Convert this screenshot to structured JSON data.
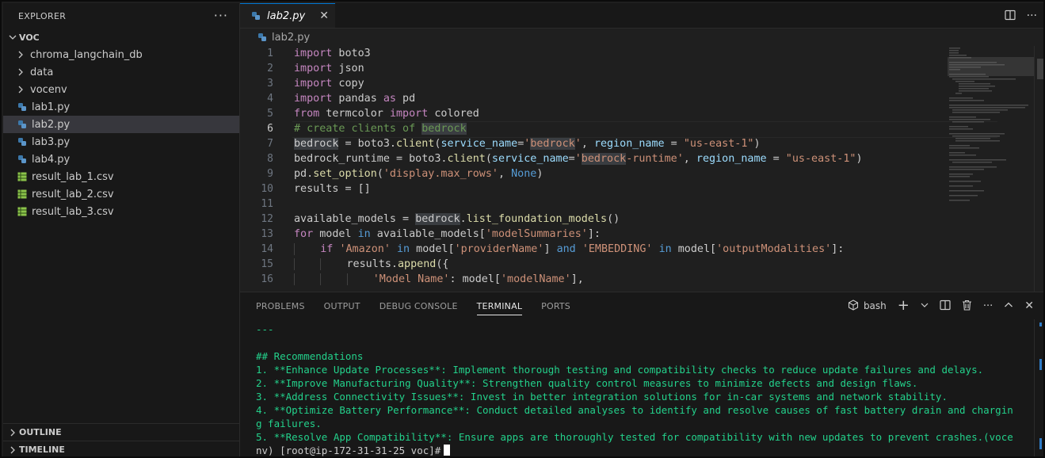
{
  "explorer": {
    "title": "EXPLORER",
    "more_label": "···",
    "root": "VOC",
    "items": [
      {
        "label": "chroma_langchain_db",
        "kind": "folder"
      },
      {
        "label": "data",
        "kind": "folder"
      },
      {
        "label": "vocenv",
        "kind": "folder"
      },
      {
        "label": "lab1.py",
        "kind": "py"
      },
      {
        "label": "lab2.py",
        "kind": "py"
      },
      {
        "label": "lab3.py",
        "kind": "py"
      },
      {
        "label": "lab4.py",
        "kind": "py"
      },
      {
        "label": "result_lab_1.csv",
        "kind": "csv"
      },
      {
        "label": "result_lab_2.csv",
        "kind": "csv"
      },
      {
        "label": "result_lab_3.csv",
        "kind": "csv"
      }
    ],
    "outline": "OUTLINE",
    "timeline": "TIMELINE"
  },
  "editor": {
    "tab_label": "lab2.py",
    "breadcrumb": "lab2.py",
    "line_numbers": [
      "1",
      "2",
      "3",
      "4",
      "5",
      "6",
      "7",
      "8",
      "9",
      "10",
      "11",
      "12",
      "13",
      "14",
      "15",
      "16"
    ]
  },
  "panel": {
    "tabs": [
      "PROBLEMS",
      "OUTPUT",
      "DEBUG CONSOLE",
      "TERMINAL",
      "PORTS"
    ],
    "active_tab": "TERMINAL",
    "shell_label": "bash",
    "terminal_lines": [
      "---",
      "",
      "## Recommendations",
      "1. **Enhance Update Processes**: Implement thorough testing and compatibility checks to reduce update failures and delays.",
      "2. **Improve Manufacturing Quality**: Strengthen quality control measures to minimize defects and design flaws.",
      "3. **Address Connectivity Issues**: Invest in better integration solutions for in-car systems and network stability.",
      "4. **Optimize Battery Performance**: Conduct detailed analyses to identify and resolve causes of fast battery drain and chargin",
      "g failures.",
      "5. **Resolve App Compatibility**: Ensure apps are thoroughly tested for compatibility with new updates to prevent crashes.(voce"
    ],
    "prompt_line": "nv) [root@ip-172-31-31-25 voc]#"
  }
}
